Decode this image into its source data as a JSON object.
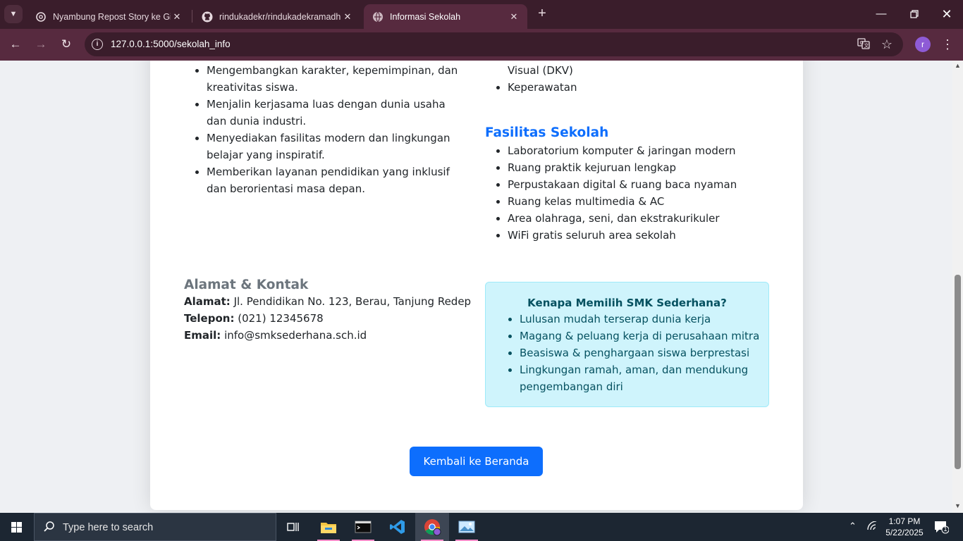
{
  "browser": {
    "tabs": [
      {
        "title": "Nyambung Repost Story ke Git"
      },
      {
        "title": "rindukadekr/rindukadekramadh"
      },
      {
        "title": "Informasi Sekolah"
      }
    ],
    "url_host": "127.0.0.1",
    "url_path": ":5000/sekolah_info",
    "profile_initial": "r"
  },
  "page": {
    "mission_items": [
      "Mengembangkan karakter, kepemimpinan, dan kreativitas siswa.",
      "Menjalin kerjasama luas dengan dunia usaha dan dunia industri.",
      "Menyediakan fasilitas modern dan lingkungan belajar yang inspiratif.",
      "Memberikan layanan pendidikan yang inklusif dan berorientasi masa depan."
    ],
    "jurusan_partial": "Visual (DKV)",
    "jurusan_items": [
      "Keperawatan"
    ],
    "fasilitas": {
      "title": "Fasilitas Sekolah",
      "items": [
        "Laboratorium komputer & jaringan modern",
        "Ruang praktik kejuruan lengkap",
        "Perpustakaan digital & ruang baca nyaman",
        "Ruang kelas multimedia & AC",
        "Area olahraga, seni, dan ekstrakurikuler",
        "WiFi gratis seluruh area sekolah"
      ]
    },
    "contact": {
      "title": "Alamat & Kontak",
      "alamat_label": "Alamat:",
      "alamat": "Jl. Pendidikan No. 123, Berau, Tanjung Redep",
      "telepon_label": "Telepon:",
      "telepon": "(021) 12345678",
      "email_label": "Email:",
      "email": "info@smksederhana.sch.id"
    },
    "why": {
      "title": "Kenapa Memilih SMK Sederhana?",
      "items": [
        "Lulusan mudah terserap dunia kerja",
        "Magang & peluang kerja di perusahaan mitra",
        "Beasiswa & penghargaan siswa berprestasi",
        "Lingkungan ramah, aman, dan mendukung pengembangan diri"
      ]
    },
    "back_button": "Kembali ke Beranda"
  },
  "taskbar": {
    "search_placeholder": "Type here to search",
    "time": "1:07 PM",
    "date": "5/22/2025",
    "notification_count": "1"
  },
  "colors": {
    "primary": "#0d6efd",
    "heading_muted": "#6c757d",
    "info_bg": "#cff4fc",
    "info_text": "#055160",
    "chrome_frame": "#3a1d2b",
    "chrome_toolbar": "#572a3f"
  }
}
